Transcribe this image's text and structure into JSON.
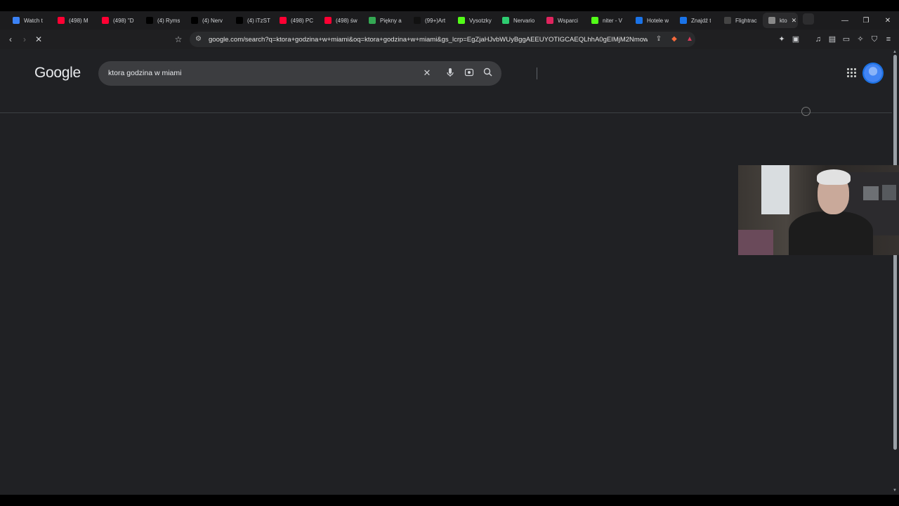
{
  "tabs": [
    {
      "title": "Watch t",
      "favicon": "globe-icon",
      "color": "#3b82f6",
      "active": false
    },
    {
      "title": "(498) M",
      "favicon": "youtube-icon",
      "color": "#ff0033",
      "active": false
    },
    {
      "title": "(498) \"D",
      "favicon": "youtube-icon",
      "color": "#ff0033",
      "active": false
    },
    {
      "title": "(4) Ryms",
      "favicon": "x-icon",
      "color": "#000000",
      "active": false
    },
    {
      "title": "(4) Nerv",
      "favicon": "x-icon",
      "color": "#000000",
      "active": false
    },
    {
      "title": "(4) iTzST",
      "favicon": "x-icon",
      "color": "#000000",
      "active": false
    },
    {
      "title": "(498) PC",
      "favicon": "youtube-icon",
      "color": "#ff0033",
      "active": false
    },
    {
      "title": "(498) św",
      "favicon": "youtube-icon",
      "color": "#ff0033",
      "active": false
    },
    {
      "title": "Piękny a",
      "favicon": "maps-pin-icon",
      "color": "#34a853",
      "active": false
    },
    {
      "title": "(99+)Art",
      "favicon": "tiktok-icon",
      "color": "#111111",
      "active": false
    },
    {
      "title": "Vysotzky",
      "favicon": "kick-icon",
      "color": "#53fc18",
      "active": false
    },
    {
      "title": "Nervario",
      "favicon": "tt-icon",
      "color": "#2ecc71",
      "active": false
    },
    {
      "title": "Wsparci",
      "favicon": "tipply-icon",
      "color": "#e0245e",
      "active": false
    },
    {
      "title": "niter - V",
      "favicon": "kick-icon",
      "color": "#53fc18",
      "active": false
    },
    {
      "title": "Hotele w",
      "favicon": "booking-icon",
      "color": "#1a73e8",
      "active": false
    },
    {
      "title": "Znajdź t",
      "favicon": "booking-icon",
      "color": "#1a73e8",
      "active": false
    },
    {
      "title": "Flightrac",
      "favicon": "flightradar-icon",
      "color": "#444444",
      "active": false
    },
    {
      "title": "kto",
      "favicon": "loading-icon",
      "color": "#888888",
      "active": true
    }
  ],
  "address_bar": {
    "url": "google.com/search?q=ktora+godzina+w+miami&oq=ktora+godzina+w+miami&gs_lcrp=EgZjaHJvbWUyBggAEEUYOTIGCAEQLhhA0gEIMjM2Nmow..."
  },
  "google": {
    "logo": "Google",
    "query": "ktora godzina w miami"
  },
  "glyphs": {
    "close": "✕",
    "mic": "🎙",
    "lens": "◎",
    "search": "⚲",
    "back": "‹",
    "forward": "›",
    "stop": "✕",
    "bookmark": "☆",
    "tune": "⚙",
    "share": "⇪",
    "minimize": "—",
    "maximize": "❐",
    "window_close": "✕"
  }
}
